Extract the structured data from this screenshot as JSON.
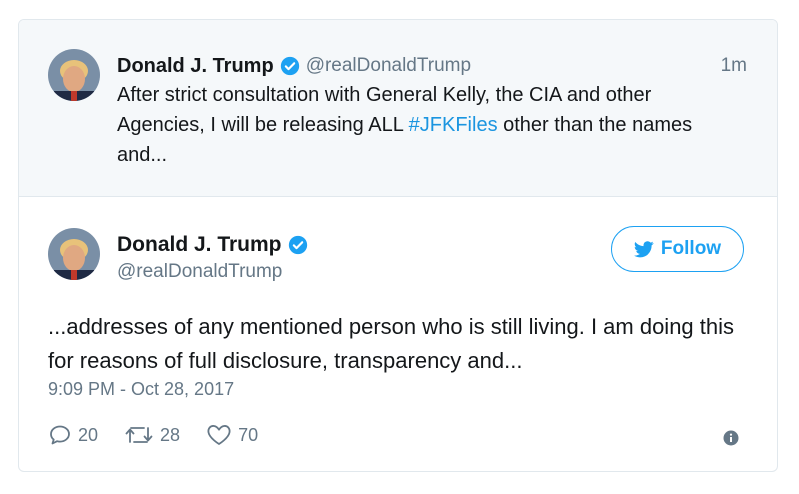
{
  "colors": {
    "accent": "#1da1f2",
    "hashtag": "#1b95e0",
    "muted": "#657786",
    "text": "#14171a"
  },
  "parent_tweet": {
    "name": "Donald J. Trump",
    "handle": "@realDonaldTrump",
    "time": "1m",
    "text_before": "After strict consultation with General Kelly, the CIA and other Agencies, I will be releasing ALL ",
    "hashtag": "#JFKFiles",
    "text_after": " other than the names and..."
  },
  "main_tweet": {
    "name": "Donald J. Trump",
    "handle": "@realDonaldTrump",
    "follow_label": "Follow",
    "text": "...addresses of any mentioned person who is still living. I am doing this for reasons of full disclosure, transparency and...",
    "timestamp": "9:09 PM - Oct 28, 2017",
    "replies": "20",
    "retweets": "28",
    "likes": "70"
  },
  "icons": [
    "verified-badge-icon",
    "twitter-bird-icon",
    "reply-icon",
    "retweet-icon",
    "heart-icon",
    "info-icon"
  ]
}
